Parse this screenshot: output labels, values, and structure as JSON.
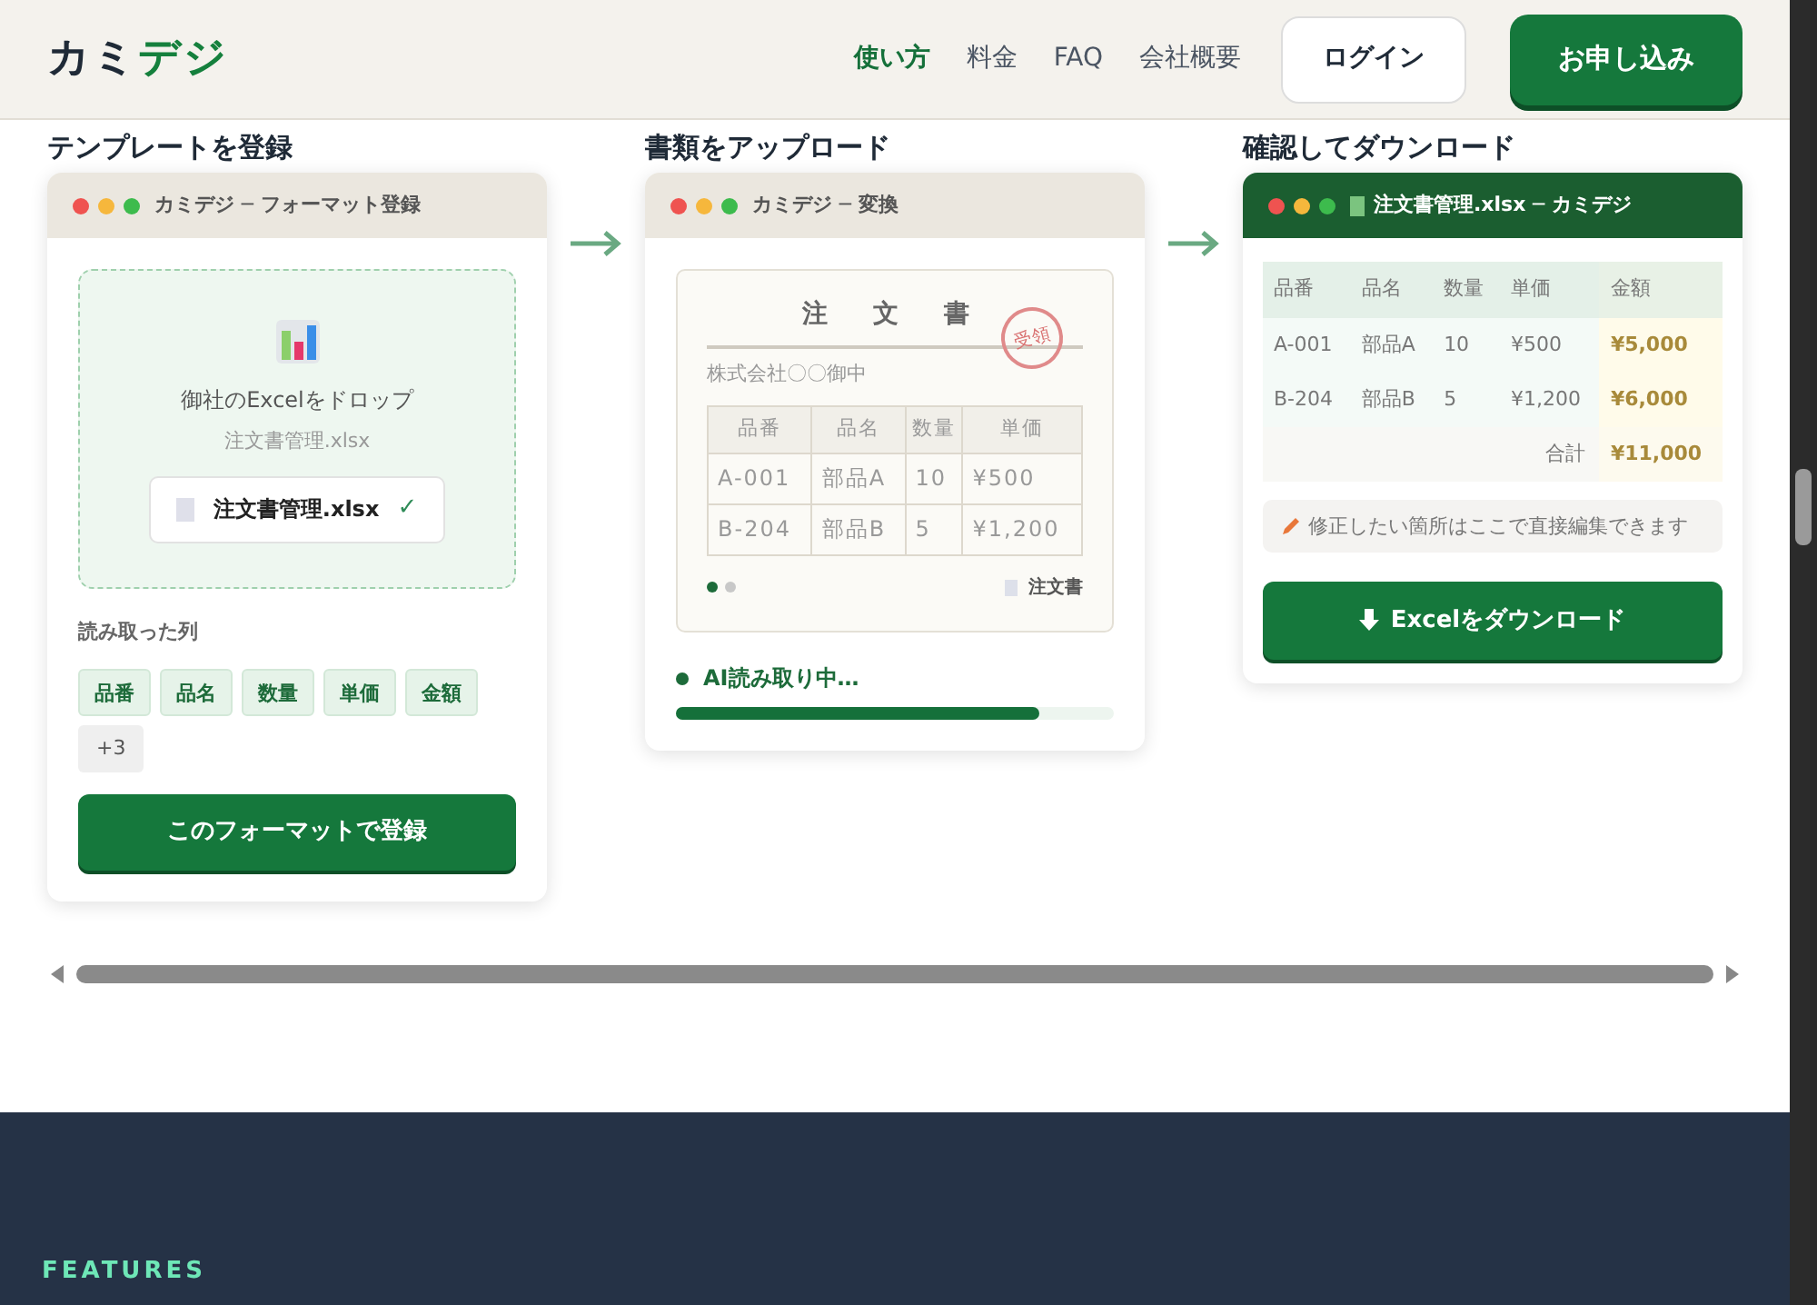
{
  "header": {
    "logo": [
      "カミ",
      "デジ"
    ],
    "nav": [
      {
        "label": "使い方",
        "selected": true
      },
      {
        "label": "料金",
        "selected": false
      },
      {
        "label": "FAQ",
        "selected": false
      },
      {
        "label": "会社概要",
        "selected": false
      }
    ],
    "login": "ログイン",
    "apply": "お申し込み"
  },
  "steps": [
    {
      "kind": "template",
      "heading": "テンプレートを登録",
      "window_title": "カミデジ ─ フォーマット登録",
      "drop_text": "御社のExcelをドロップ",
      "drop_hint": "注文書管理.xlsx",
      "file_name": "注文書管理.xlsx",
      "check": "✓",
      "columns_label": "読み取った列",
      "columns": [
        "品番",
        "品名",
        "数量",
        "単価",
        "金額"
      ],
      "more": "+3",
      "button": "このフォーマットで登録"
    },
    {
      "kind": "upload",
      "heading": "書類をアップロード",
      "window_title": "カミデジ ─ 変換",
      "doc_title": "注 文 書",
      "stamp": "受領",
      "company": "株式会社〇〇御中",
      "table_columns": [
        "品番",
        "品名",
        "数量",
        "単価"
      ],
      "table_rows": [
        [
          "A-001",
          "部品A",
          "10",
          "¥500"
        ],
        [
          "B-204",
          "部品B",
          "5",
          "¥1,200"
        ]
      ],
      "pages": [
        {
          "selected": true
        },
        {
          "selected": false
        }
      ],
      "doc_label": "注文書",
      "status": "AI読み取り中…",
      "level": 0.83
    },
    {
      "kind": "download",
      "heading": "確認してダウンロード",
      "window_title": "注文書管理.xlsx ─ カミデジ",
      "table_columns": [
        "品番",
        "品名",
        "数量",
        "単価",
        "金額"
      ],
      "table_rows": [
        [
          "A-001",
          "部品A",
          "10",
          "¥500",
          "¥5,000"
        ],
        [
          "B-204",
          "部品B",
          "5",
          "¥1,200",
          "¥6,000"
        ]
      ],
      "total_label": "合計",
      "total": "¥11,000",
      "note": "修正したい箇所はここで直接編集できます",
      "button": "Excelをダウンロード"
    }
  ],
  "features_label": "FEATURES"
}
